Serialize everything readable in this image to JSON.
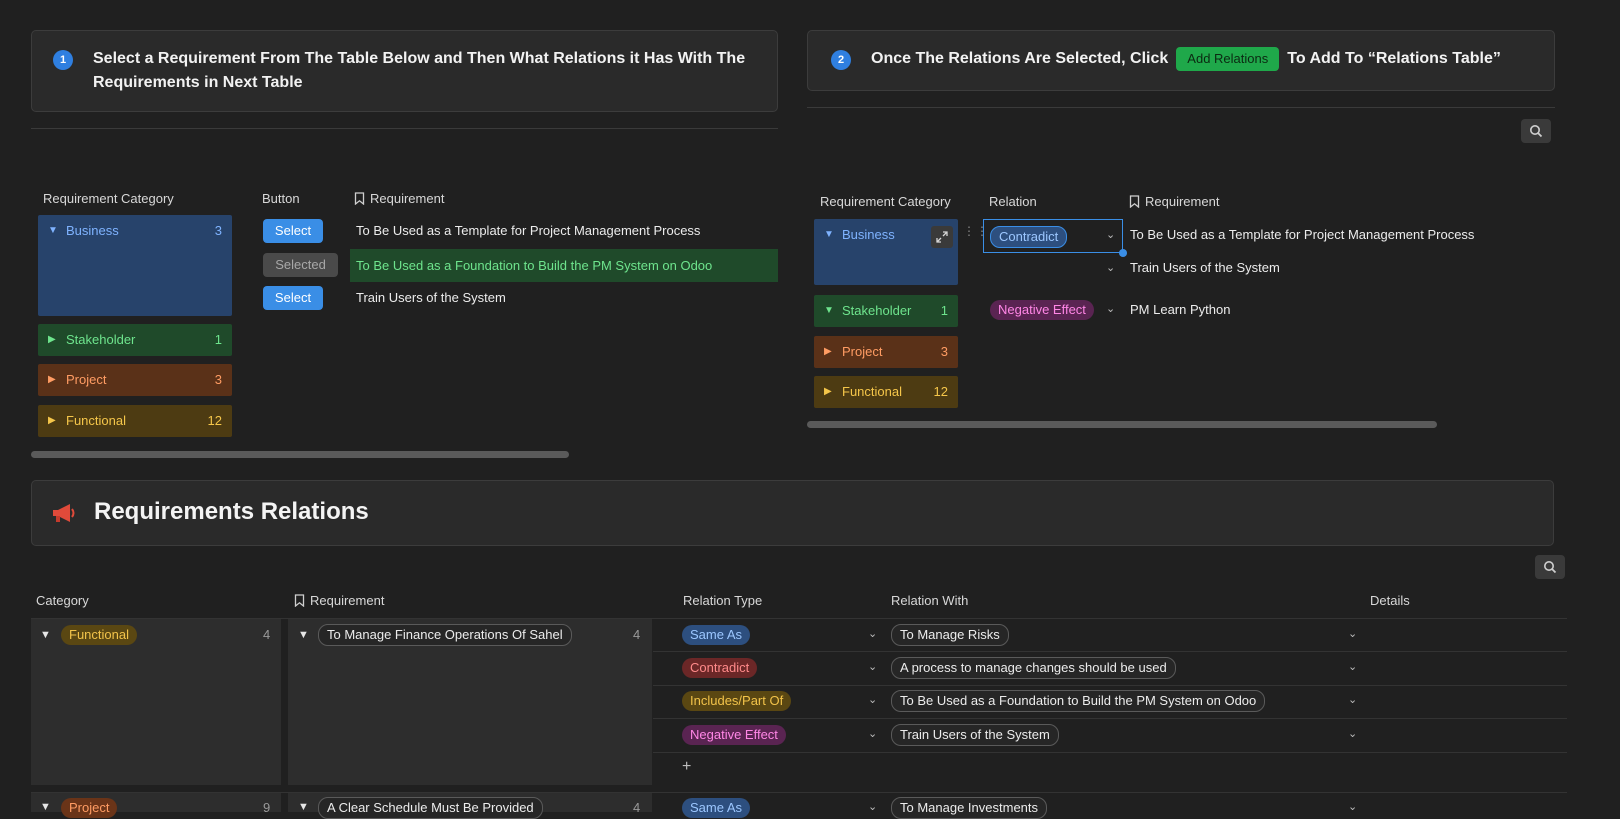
{
  "step1": {
    "num": "1",
    "title_line1": "Select a Requirement From The Table Below and Then What Relations it Has With The",
    "title_line2": "Requirements in Next Table"
  },
  "step2": {
    "num": "2",
    "title_before": "Once The Relations Are Selected, Click",
    "button": "Add Relations",
    "title_after": "To Add To “Relations Table”"
  },
  "left_table": {
    "headers": {
      "category": "Requirement Category",
      "button": "Button",
      "requirement": "Requirement"
    },
    "groups": [
      {
        "name": "Business",
        "count": "3"
      },
      {
        "name": "Stakeholder",
        "count": "1"
      },
      {
        "name": "Project",
        "count": "3"
      },
      {
        "name": "Functional",
        "count": "12"
      }
    ],
    "rows": [
      {
        "button": "Select",
        "requirement": "To Be Used as a Template for Project Management Process"
      },
      {
        "button": "Selected",
        "requirement": "To Be Used as a Foundation to Build the PM System on Odoo"
      },
      {
        "button": "Select",
        "requirement": "Train Users of the System"
      }
    ]
  },
  "right_table": {
    "headers": {
      "category": "Requirement Category",
      "relation": "Relation",
      "requirement": "Requirement"
    },
    "groups": [
      {
        "name": "Business",
        "count": ""
      },
      {
        "name": "Stakeholder",
        "count": "1"
      },
      {
        "name": "Project",
        "count": "3"
      },
      {
        "name": "Functional",
        "count": "12"
      }
    ],
    "rows": [
      {
        "relation": "Contradict",
        "requirement": "To Be Used as a Template for Project Management Process"
      },
      {
        "relation": "",
        "requirement": "Train Users of the System"
      },
      {
        "relation": "Negative Effect",
        "requirement": "PM Learn Python"
      }
    ]
  },
  "relations_section": {
    "icon": "megaphone-icon",
    "title": "Requirements Relations"
  },
  "relations_table": {
    "headers": {
      "category": "Category",
      "requirement": "Requirement",
      "relation_type": "Relation Type",
      "relation_with": "Relation With",
      "details": "Details"
    },
    "group1": {
      "category": "Functional",
      "category_count": "4",
      "requirement": "To Manage Finance Operations Of Sahel",
      "requirement_count": "4"
    },
    "rows": [
      {
        "type": "Same As",
        "with": "To Manage Risks"
      },
      {
        "type": "Contradict",
        "with": "A process to manage changes should be used"
      },
      {
        "type": "Includes/Part Of",
        "with": "To Be Used as a Foundation to Build the PM System on Odoo"
      },
      {
        "type": "Negative Effect",
        "with": "Train Users of the System"
      }
    ],
    "add_row": "+",
    "group2": {
      "category": "Project",
      "category_count": "9",
      "requirement": "A Clear Schedule Must Be Provided",
      "requirement_count": "4",
      "type": "Same As",
      "with": "To Manage Investments"
    }
  },
  "colors": {
    "background": "#202020",
    "accent_blue": "#2f7fe0",
    "add_button": "#1fa84a"
  }
}
